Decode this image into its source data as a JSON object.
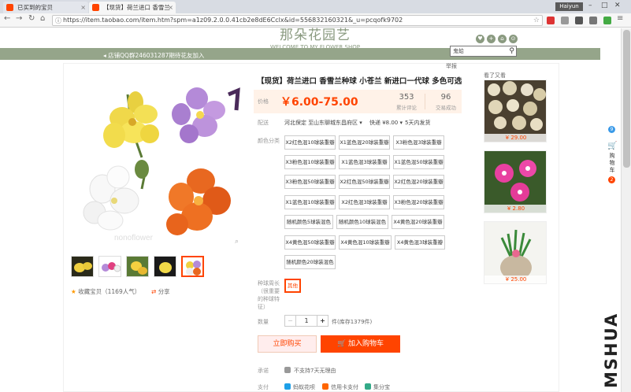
{
  "browser": {
    "tabs": [
      {
        "label": "已买到的宝贝",
        "color": "#f40"
      },
      {
        "label": "【现货】荷兰进口 香雪兰",
        "color": "#f40"
      }
    ],
    "user": "Haiyun",
    "url": "https://item.taobao.com/item.htm?spm=a1z09.2.0.0.41cb2e8dE6Cclx&id=556832160321&_u=pcqofk9702"
  },
  "shop": {
    "name": "那朵花园艺",
    "subtitle": "WELCOME TO MY FLOWER SHOP",
    "search_placeholder": "鬼蛤",
    "marquee": "店铺QQ群246031287期待花友加入",
    "report": "举报"
  },
  "product": {
    "title": "【现货】荷兰进口 香雪兰种球 小苍兰 新进口一代球 多色可选",
    "price_label": "价格",
    "price": "￥6.00-75.00",
    "reviews": {
      "num": "353",
      "label": "累计评论"
    },
    "sold": {
      "num": "96",
      "label": "交易成功"
    },
    "shipping_label": "配送",
    "shipping_from": "河北保定 至",
    "shipping_to": "山东聊城东昌府区 ▾",
    "shipping_fee": "快递 ¥8.00 ▾",
    "shipping_time": "5天内发货",
    "color_label": "颜色分类",
    "options": [
      [
        "X2红色混10球装重瓣",
        "X1蓝色混20球装重瓣",
        "X3粉色混3球装重瓣"
      ],
      [
        "X3粉色混10球装重瓣",
        "X1蓝色混3球装重瓣",
        "X1蓝色混50球装重瓣"
      ],
      [
        "X3粉色混50球装重瓣",
        "X2红色混50球装重瓣",
        "X2红色混20球装重瓣"
      ],
      [
        "X1蓝色混10球装重瓣",
        "X2红色混3球装重瓣",
        "X3粉色混20球装重瓣"
      ],
      [
        "随机颜色5球装混色",
        "随机颜色10球装混色",
        "X4黄色混20球装重瓣"
      ],
      [
        "X4黄色混50球装重瓣",
        "X4黄色混10球装重瓣",
        "X4黄色混3球装重瓣"
      ],
      [
        "随机颜色20球装混色"
      ]
    ],
    "period_label": "种球周长（很重要的种球特征）",
    "period_option": "其他",
    "qty_label": "数量",
    "qty_minus": "−",
    "qty_value": "1",
    "qty_plus": "+",
    "stock": "件(库存1379件)",
    "buy_now": "立即购买",
    "add_cart": "加入购物车",
    "promise_label": "承诺",
    "promise_text": "不支持7天无理由",
    "pay_label": "支付",
    "pay_methods": [
      "蚂蚁花呗",
      "信用卡支付",
      "集分宝"
    ],
    "fav": "收藏宝贝（1169人气）",
    "share": "分享"
  },
  "recommend": {
    "label": "看了又看",
    "items": [
      {
        "price": "¥ 29.00"
      },
      {
        "price": "¥ 2.80"
      },
      {
        "price": "¥ 25.00"
      }
    ]
  },
  "side": {
    "cart_text": "购物车",
    "cart_count": "2",
    "watermark": "MSHUA"
  },
  "colors": {
    "accent": "#ff4400",
    "shop_green": "#95a58a"
  }
}
